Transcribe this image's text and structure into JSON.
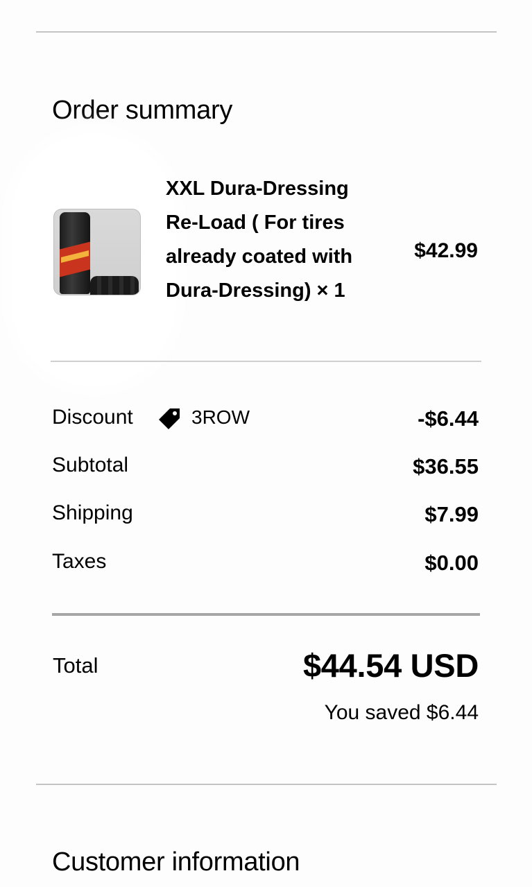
{
  "order_summary": {
    "title": "Order summary",
    "item": {
      "name": "XXL Dura-Dressing Re-Load ( For tires already coated with Dura-Dressing) × 1",
      "price": "$42.99",
      "image_icon": "product-photo"
    },
    "discount": {
      "label": "Discount",
      "icon": "tag-icon",
      "code": "3ROW",
      "amount": "-$6.44"
    },
    "subtotal": {
      "label": "Subtotal",
      "amount": "$36.55"
    },
    "shipping": {
      "label": "Shipping",
      "amount": "$7.99"
    },
    "taxes": {
      "label": "Taxes",
      "amount": "$0.00"
    },
    "total": {
      "label": "Total",
      "amount": "$44.54 USD",
      "savings": "You saved $6.44"
    }
  },
  "customer_information": {
    "title": "Customer information"
  }
}
